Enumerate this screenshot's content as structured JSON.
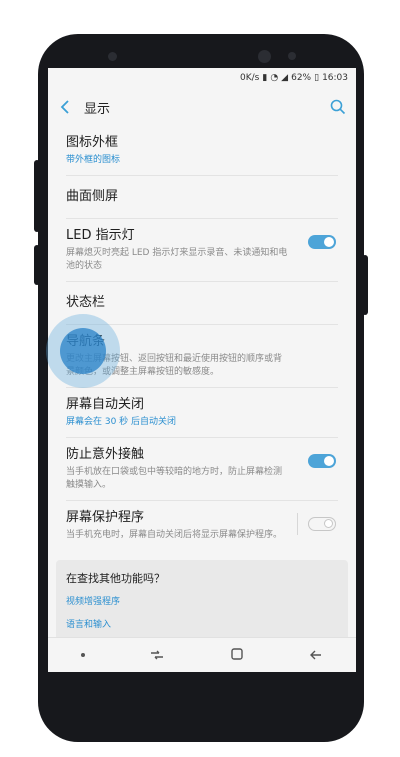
{
  "statusbar": {
    "speed": "0K/s",
    "battery": "62%",
    "time": "16:03"
  },
  "header": {
    "title": "显示"
  },
  "items": [
    {
      "title": "图标外框",
      "subtitle": "带外框的图标"
    },
    {
      "title": "曲面侧屏"
    },
    {
      "title": "LED 指示灯",
      "description": "屏幕熄灭时亮起 LED 指示灯来显示录音、未读通知和电池的状态",
      "toggle": true
    },
    {
      "title": "状态栏"
    },
    {
      "title": "导航条",
      "description": "更改主屏幕按钮、返回按钮和最近使用按钮的顺序或背景颜色，或调整主屏幕按钮的敏感度。"
    },
    {
      "title": "屏幕自动关闭",
      "subtitle": "屏幕会在 30 秒 后自动关闭"
    },
    {
      "title": "防止意外接触",
      "description": "当手机放在口袋或包中等较暗的地方时，防止屏幕检测触摸输入。",
      "toggle": true
    },
    {
      "title": "屏幕保护程序",
      "description": "当手机充电时，屏幕自动关闭后将显示屏幕保护程序。",
      "toggle": false
    }
  ],
  "card": {
    "title": "在查找其他功能吗？",
    "links": [
      "视频增强程序",
      "语言和输入"
    ]
  },
  "colors": {
    "accent": "#4da4d8",
    "link": "#2b8fd0"
  }
}
